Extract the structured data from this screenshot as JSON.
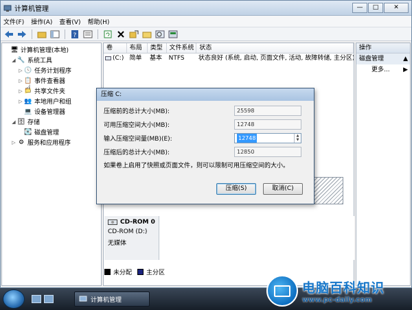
{
  "window": {
    "title": "计算机管理",
    "controls": [
      "—",
      "□",
      "✕"
    ]
  },
  "menu": [
    "文件(F)",
    "操作(A)",
    "查看(V)",
    "帮助(H)"
  ],
  "tree": [
    {
      "label": "计算机管理(本地)",
      "indent": 0,
      "exp": "",
      "icon": "computer-icon",
      "glyph": "🖥"
    },
    {
      "label": "系统工具",
      "indent": 1,
      "exp": "◢",
      "icon": "tools-icon",
      "glyph": "🔧"
    },
    {
      "label": "任务计划程序",
      "indent": 2,
      "exp": "▷",
      "icon": "clock-icon",
      "glyph": "🕓"
    },
    {
      "label": "事件查看器",
      "indent": 2,
      "exp": "▷",
      "icon": "event-viewer-icon",
      "glyph": "📋"
    },
    {
      "label": "共享文件夹",
      "indent": 2,
      "exp": "▷",
      "icon": "shared-folder-icon",
      "glyph": "📁"
    },
    {
      "label": "本地用户和组",
      "indent": 2,
      "exp": "▷",
      "icon": "users-icon",
      "glyph": "👥"
    },
    {
      "label": "设备管理器",
      "indent": 2,
      "exp": "",
      "icon": "device-manager-icon",
      "glyph": "💻"
    },
    {
      "label": "存储",
      "indent": 1,
      "exp": "◢",
      "icon": "storage-icon",
      "glyph": "🗄"
    },
    {
      "label": "磁盘管理",
      "indent": 2,
      "exp": "",
      "icon": "disk-icon",
      "glyph": "💽"
    },
    {
      "label": "服务和应用程序",
      "indent": 1,
      "exp": "▷",
      "icon": "services-icon",
      "glyph": "⚙"
    }
  ],
  "volume_table": {
    "headers": [
      "卷",
      "布局",
      "类型",
      "文件系统",
      "状态"
    ],
    "rows": [
      [
        "(C:)",
        "简单",
        "基本",
        "NTFS",
        "状态良好 (系统, 启动, 页面文件, 活动, 故障转储, 主分区)"
      ]
    ]
  },
  "cdrom": {
    "name": "CD-ROM 0",
    "drive": "CD-ROM (D:)",
    "media": "无媒体"
  },
  "legend": [
    {
      "label": "未分配",
      "color": "#000000"
    },
    {
      "label": "主分区",
      "color": "#1a237e"
    }
  ],
  "actions": {
    "header": "操作",
    "sub": "磁盘管理",
    "item": "更多..."
  },
  "dialog": {
    "title": "压缩 C:",
    "fields": [
      {
        "label": "压缩前的总计大小(MB):",
        "value": "25598"
      },
      {
        "label": "可用压缩空间大小(MB):",
        "value": "12748"
      },
      {
        "label": "输入压缩空间量(MB)(E):",
        "value": "12748"
      },
      {
        "label": "压缩后的总计大小(MB):",
        "value": "12850"
      }
    ],
    "note": "如果卷上启用了快照或页面文件，则可以限制可用压缩空间的大小。",
    "ok": "压缩(S)",
    "cancel": "取消(C)"
  },
  "taskbar": {
    "task": "计算机管理"
  },
  "watermark": {
    "name": "电脑百科知识",
    "url": "www.pc-daily.com"
  }
}
